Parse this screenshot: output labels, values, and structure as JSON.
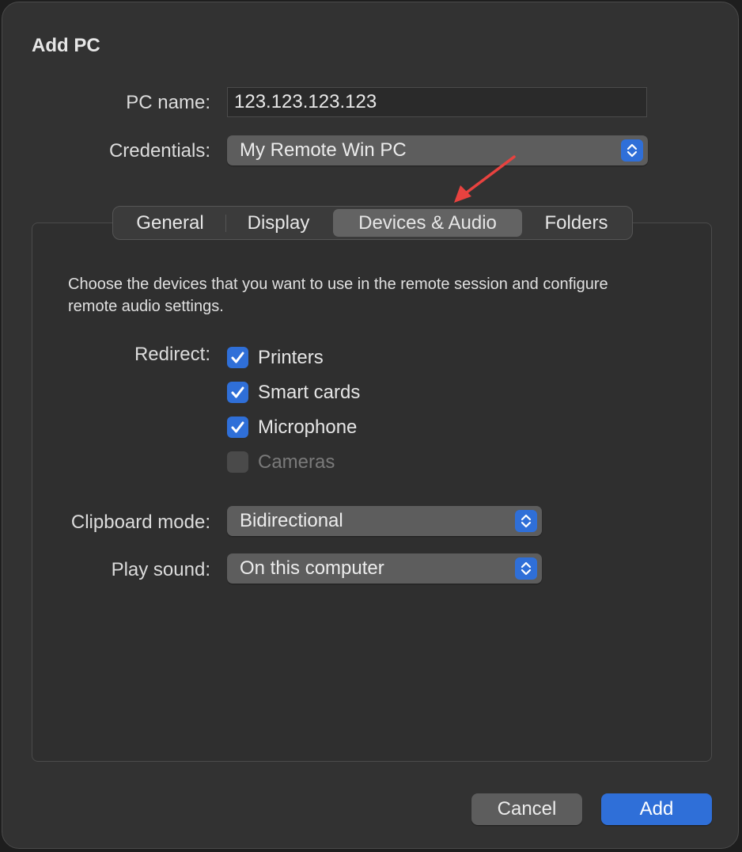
{
  "dialog": {
    "title": "Add PC"
  },
  "pc_name": {
    "label": "PC name:",
    "value": "123.123.123.123"
  },
  "credentials": {
    "label": "Credentials:",
    "selected": "My Remote Win PC"
  },
  "tabs": [
    {
      "label": "General",
      "active": false
    },
    {
      "label": "Display",
      "active": false
    },
    {
      "label": "Devices & Audio",
      "active": true
    },
    {
      "label": "Folders",
      "active": false
    }
  ],
  "devices_audio": {
    "description": "Choose the devices that you want to use in the remote session and configure remote audio settings.",
    "redirect_label": "Redirect:",
    "redirect_items": [
      {
        "label": "Printers",
        "checked": true,
        "enabled": true
      },
      {
        "label": "Smart cards",
        "checked": true,
        "enabled": true
      },
      {
        "label": "Microphone",
        "checked": true,
        "enabled": true
      },
      {
        "label": "Cameras",
        "checked": false,
        "enabled": false
      }
    ],
    "clipboard_mode": {
      "label": "Clipboard mode:",
      "selected": "Bidirectional"
    },
    "play_sound": {
      "label": "Play sound:",
      "selected": "On this computer"
    }
  },
  "buttons": {
    "cancel": "Cancel",
    "add": "Add"
  },
  "colors": {
    "accent": "#2f6fd8",
    "annotation_arrow": "#e8423f"
  }
}
